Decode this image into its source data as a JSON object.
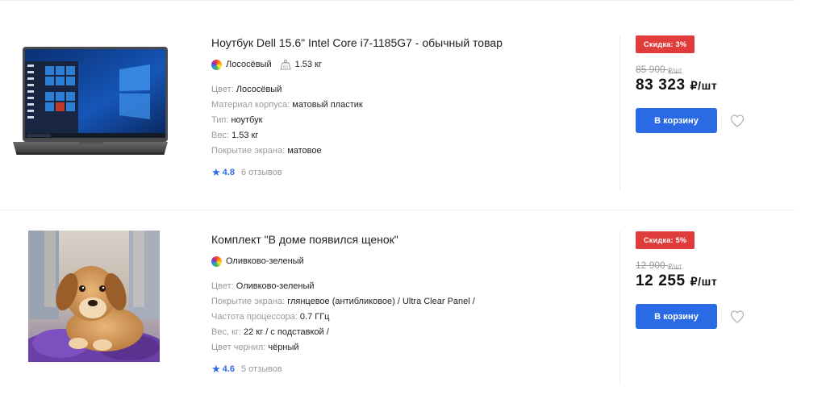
{
  "products": [
    {
      "title": "Ноутбук Dell 15.6\" Intel Core i7-1185G7 - обычный товар",
      "color_name": "Лососёвый",
      "weight": "1.53 кг",
      "specs": [
        {
          "key": "Цвет: ",
          "value": "Лососёвый"
        },
        {
          "key": "Материал корпуса: ",
          "value": "матовый пластик"
        },
        {
          "key": "Тип: ",
          "value": "ноутбук"
        },
        {
          "key": "Вес: ",
          "value": "1.53 кг"
        },
        {
          "key": "Покрытие экрана: ",
          "value": "матовое"
        }
      ],
      "rating": "4.8",
      "reviews": "6 отзывов",
      "discount": "Скидка: 3%",
      "old_price": "85 900",
      "old_unit": "₽/шт",
      "new_price": "83 323",
      "new_unit": "₽/шт",
      "cart_label": "В корзину"
    },
    {
      "title": "Комплект \"В доме появился щенок\"",
      "color_name": "Оливково-зеленый",
      "specs": [
        {
          "key": "Цвет: ",
          "value": "Оливково-зеленый"
        },
        {
          "key": "Покрытие экрана: ",
          "value": "глянцевое (антибликовое) / Ultra Clear Panel /"
        },
        {
          "key": "Частота процессора: ",
          "value": "0.7 ГГц"
        },
        {
          "key": "Вес, кг: ",
          "value": "22 кг / с подставкой /"
        },
        {
          "key": "Цвет чернил: ",
          "value": "чёрный"
        }
      ],
      "rating": "4.6",
      "reviews": "5 отзывов",
      "discount": "Скидка: 5%",
      "old_price": "12 900",
      "old_unit": "₽/шт",
      "new_price": "12 255",
      "new_unit": "₽/шт",
      "cart_label": "В корзину"
    }
  ],
  "colors": {
    "accent": "#2a6ae4",
    "discount_badge": "#e03c3c",
    "rating": "#2e6ee6",
    "muted_text": "#9a9a9a"
  },
  "icons": {
    "color": "color-swatch-icon",
    "weight": "weight-icon",
    "rating": "star-icon",
    "favorite": "heart-icon"
  }
}
